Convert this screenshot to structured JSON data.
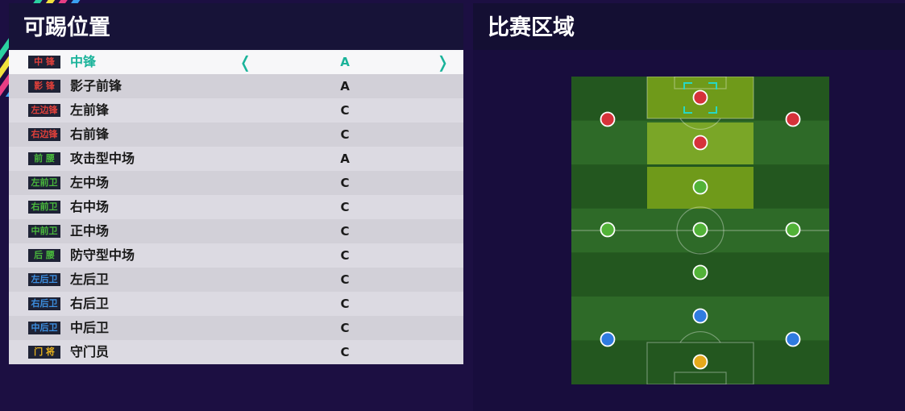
{
  "left_panel": {
    "title": "可踢位置",
    "selected_arrow_left": "❬",
    "selected_arrow_right": "❭",
    "positions": [
      {
        "badge": "中 锋",
        "name": "中锋",
        "grade": "A",
        "badge_color": "#e0403a"
      },
      {
        "badge": "影 锋",
        "name": "影子前锋",
        "grade": "A",
        "badge_color": "#e0403a"
      },
      {
        "badge": "左边锋",
        "name": "左前锋",
        "grade": "C",
        "badge_color": "#e0403a"
      },
      {
        "badge": "右边锋",
        "name": "右前锋",
        "grade": "C",
        "badge_color": "#e0403a"
      },
      {
        "badge": "前 腰",
        "name": "攻击型中场",
        "grade": "A",
        "badge_color": "#49b93c"
      },
      {
        "badge": "左前卫",
        "name": "左中场",
        "grade": "C",
        "badge_color": "#49b93c"
      },
      {
        "badge": "右前卫",
        "name": "右中场",
        "grade": "C",
        "badge_color": "#49b93c"
      },
      {
        "badge": "中前卫",
        "name": "正中场",
        "grade": "C",
        "badge_color": "#49b93c"
      },
      {
        "badge": "后 腰",
        "name": "防守型中场",
        "grade": "C",
        "badge_color": "#49b93c"
      },
      {
        "badge": "左后卫",
        "name": "左后卫",
        "grade": "C",
        "badge_color": "#3c8ee0"
      },
      {
        "badge": "右后卫",
        "name": "右后卫",
        "grade": "C",
        "badge_color": "#3c8ee0"
      },
      {
        "badge": "中后卫",
        "name": "中后卫",
        "grade": "C",
        "badge_color": "#3c8ee0"
      },
      {
        "badge": "门 将",
        "name": "守门员",
        "grade": "C",
        "badge_color": "#e8b21c"
      }
    ]
  },
  "right_panel": {
    "title": "比赛区域",
    "pitch_markers": [
      {
        "role": "center-forward",
        "color": "#d6323a"
      },
      {
        "role": "left-wing",
        "color": "#d6323a"
      },
      {
        "role": "right-wing",
        "color": "#d6323a"
      },
      {
        "role": "second-striker",
        "color": "#d6323a"
      },
      {
        "role": "attacking-midfield",
        "color": "#52b238"
      },
      {
        "role": "left-midfield",
        "color": "#52b238"
      },
      {
        "role": "center-midfield",
        "color": "#52b238"
      },
      {
        "role": "right-midfield",
        "color": "#52b238"
      },
      {
        "role": "defensive-midfield",
        "color": "#52b238"
      },
      {
        "role": "center-back",
        "color": "#2f7be0"
      },
      {
        "role": "left-back",
        "color": "#2f7be0"
      },
      {
        "role": "right-back",
        "color": "#2f7be0"
      },
      {
        "role": "goalkeeper",
        "color": "#e5a91c"
      }
    ]
  }
}
